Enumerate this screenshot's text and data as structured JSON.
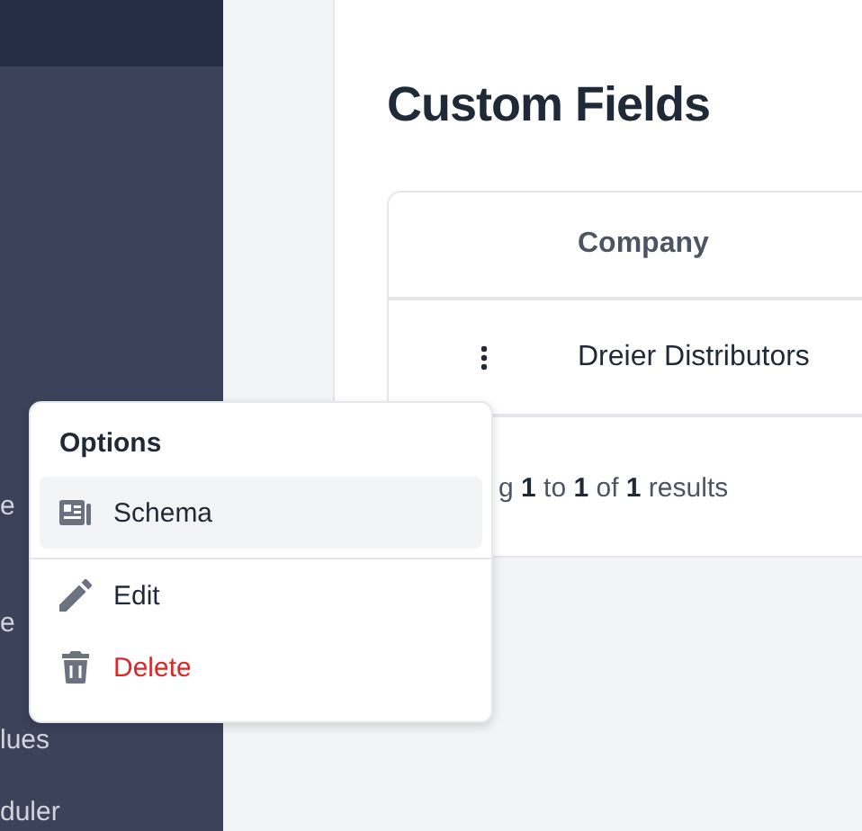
{
  "sidebar": {
    "items": [
      {
        "label": "e"
      },
      {
        "label": "e"
      },
      {
        "label": "lues"
      },
      {
        "label": "duler"
      }
    ]
  },
  "page": {
    "title": "Custom Fields"
  },
  "table": {
    "columns": [
      "Company"
    ],
    "rows": [
      {
        "cells": [
          "Dreier Distributors"
        ]
      }
    ]
  },
  "pagination": {
    "summary": "g **1** to **1** of **1** results"
  },
  "menu": {
    "title": "Options",
    "items": [
      {
        "label": "Schema",
        "kind": "schema",
        "selected": true,
        "danger": false
      },
      {
        "label": "Edit",
        "kind": "edit",
        "selected": false,
        "danger": false
      },
      {
        "label": "Delete",
        "kind": "delete",
        "selected": false,
        "danger": true
      }
    ]
  }
}
